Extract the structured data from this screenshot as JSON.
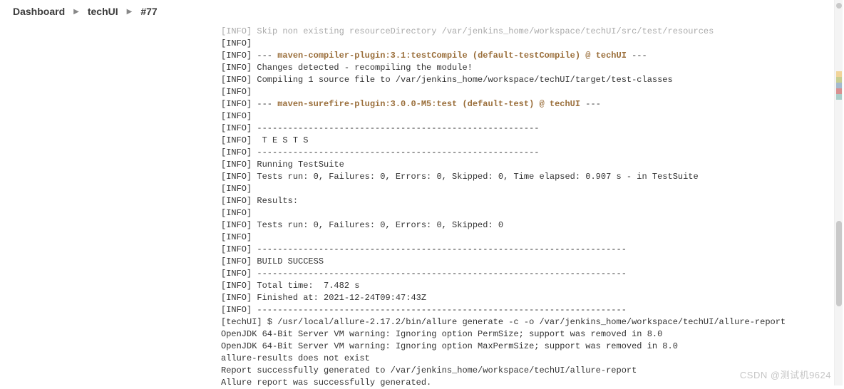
{
  "breadcrumb": {
    "items": [
      "Dashboard",
      "techUI",
      "#77"
    ]
  },
  "console": {
    "lines": [
      {
        "prefix": "[INFO]",
        "text": " Skip non existing resourceDirectory /var/jenkins_home/workspace/techUI/src/test/resources",
        "cut": true
      },
      {
        "prefix": "[INFO]",
        "text": ""
      },
      {
        "prefix": "[INFO]",
        "text": " --- ",
        "hl": "maven-compiler-plugin:3.1:testCompile (default-testCompile) @ techUI",
        "tail": " ---"
      },
      {
        "prefix": "[INFO]",
        "text": " Changes detected - recompiling the module!"
      },
      {
        "prefix": "[INFO]",
        "text": " Compiling 1 source file to /var/jenkins_home/workspace/techUI/target/test-classes"
      },
      {
        "prefix": "[INFO]",
        "text": ""
      },
      {
        "prefix": "[INFO]",
        "text": " --- ",
        "hl": "maven-surefire-plugin:3.0.0-M5:test (default-test) @ techUI",
        "tail": " ---"
      },
      {
        "prefix": "[INFO]",
        "text": ""
      },
      {
        "prefix": "[INFO]",
        "text": " -------------------------------------------------------"
      },
      {
        "prefix": "[INFO]",
        "text": "  T E S T S"
      },
      {
        "prefix": "[INFO]",
        "text": " -------------------------------------------------------"
      },
      {
        "prefix": "[INFO]",
        "text": " Running TestSuite"
      },
      {
        "prefix": "[INFO]",
        "text": " Tests run: 0, Failures: 0, Errors: 0, Skipped: 0, Time elapsed: 0.907 s - in TestSuite"
      },
      {
        "prefix": "[INFO]",
        "text": ""
      },
      {
        "prefix": "[INFO]",
        "text": " Results:"
      },
      {
        "prefix": "[INFO]",
        "text": ""
      },
      {
        "prefix": "[INFO]",
        "text": " Tests run: 0, Failures: 0, Errors: 0, Skipped: 0"
      },
      {
        "prefix": "[INFO]",
        "text": ""
      },
      {
        "prefix": "[INFO]",
        "text": " ------------------------------------------------------------------------"
      },
      {
        "prefix": "[INFO]",
        "text": " BUILD SUCCESS"
      },
      {
        "prefix": "[INFO]",
        "text": " ------------------------------------------------------------------------"
      },
      {
        "prefix": "[INFO]",
        "text": " Total time:  7.482 s"
      },
      {
        "prefix": "[INFO]",
        "text": " Finished at: 2021-12-24T09:47:43Z"
      },
      {
        "prefix": "[INFO]",
        "text": " ------------------------------------------------------------------------"
      },
      {
        "prefix": "[techUI]",
        "text": " $ /usr/local/allure-2.17.2/bin/allure generate -c -o /var/jenkins_home/workspace/techUI/allure-report"
      },
      {
        "prefix": "",
        "text": "OpenJDK 64-Bit Server VM warning: Ignoring option PermSize; support was removed in 8.0"
      },
      {
        "prefix": "",
        "text": "OpenJDK 64-Bit Server VM warning: Ignoring option MaxPermSize; support was removed in 8.0"
      },
      {
        "prefix": "",
        "text": "allure-results does not exist"
      },
      {
        "prefix": "",
        "text": "Report successfully generated to /var/jenkins_home/workspace/techUI/allure-report"
      },
      {
        "prefix": "",
        "text": "Allure report was successfully generated."
      }
    ]
  },
  "watermark": "CSDN @测试机9624"
}
